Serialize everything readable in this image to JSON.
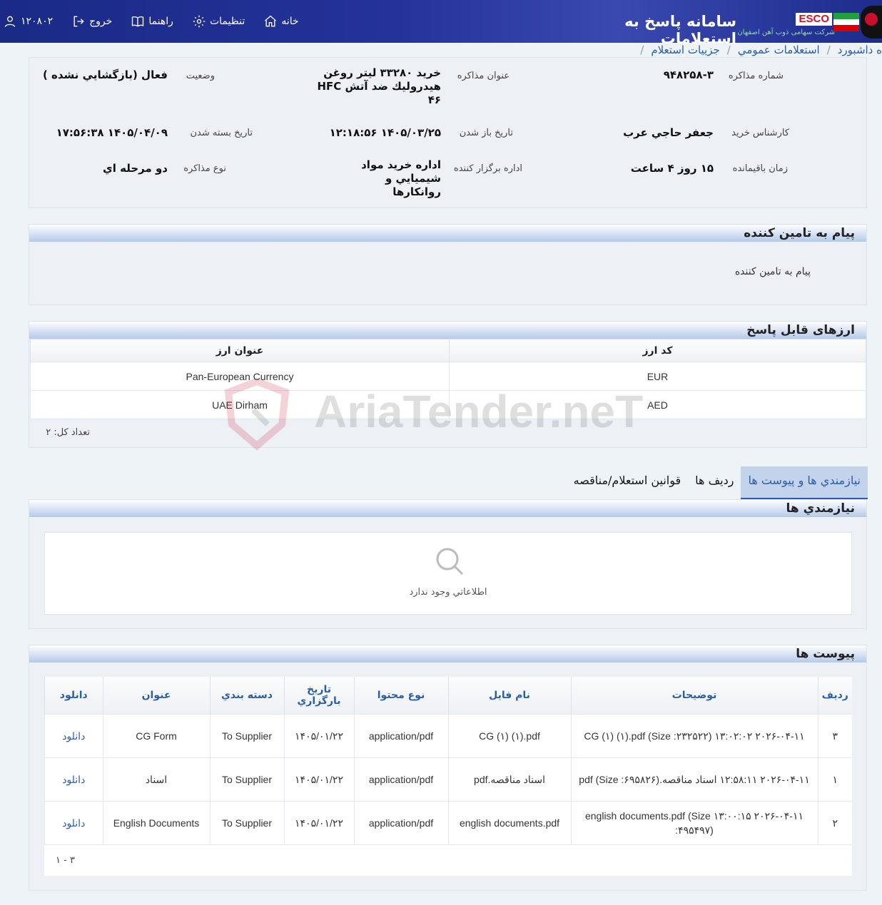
{
  "header": {
    "title": "سامانه پاسخ به استعلامات",
    "logo_text": "ESCO",
    "company": "شرکت سهامی ذوب آهن اصفهان",
    "nav": {
      "home": "خانه",
      "settings": "تنظیمات",
      "help": "راهنما",
      "logout": "خروج",
      "user": "۱۲۰۸۰۲"
    }
  },
  "breadcrumb": {
    "dashboard": "ه داشبورد",
    "public": "استعلامات عمومي",
    "details": "جزييات استعلام"
  },
  "info": {
    "number_label": "شماره مذاکره",
    "number_value": "۹۴۸۲۵۸-۳",
    "subject_label": "عنوان مذاکره",
    "subject_value": "خرید ۳۳۲۸۰ لیتر روغن هیدرولیك ضد آتش HFC ۴۶",
    "status_label": "وضعيت",
    "status_value": "فعال (بازگشايي نشده )",
    "expert_label": "كارشناس خريد",
    "expert_value": "جعفر حاجي عرب",
    "open_label": "تاريخ باز شدن",
    "open_value": "۱۴۰۵/۰۳/۲۵ ۱۲:۱۸:۵۶",
    "close_label": "تاريخ بسته شدن",
    "close_value": "۱۴۰۵/۰۴/۰۹ ۱۷:۵۶:۳۸",
    "remaining_label": "زمان باقيمانده",
    "remaining_value": "۱۵ روز ۴ ساعت",
    "office_label": "اداره برگزار کننده",
    "office_value": "اداره خريد مواد شيميايي و روانكارها",
    "type_label": "نوع مذاكره",
    "type_value": "دو مرحله اي"
  },
  "message": {
    "title": "پيام به تامين كننده",
    "text": "پيام به تامين كننده"
  },
  "currencies": {
    "title": "ارزهای قابل پاسخ",
    "col_code": "کد ارز",
    "col_title": "عنوان ارز",
    "rows": [
      {
        "code": "EUR",
        "title": "Pan-European Currency"
      },
      {
        "code": "AED",
        "title": "UAE Dirham"
      }
    ],
    "count": "تعداد كل: ۲"
  },
  "tabs": {
    "needs_attach": "نيازمندي ها و پيوست ها",
    "rows": "رديف ها",
    "rules": "قوانين استعلام/مناقصه"
  },
  "needs": {
    "title": "نيازمندي ها",
    "empty": "اطلاعاتي وجود ندارد"
  },
  "attachments": {
    "title": "پيوست ها",
    "headers": {
      "row": "رديف",
      "desc": "توضيحات",
      "file": "نام فايل",
      "type": "نوع محتوا",
      "date": "تاريخ بارگزاري",
      "category": "دسته بندي",
      "name": "عنوان",
      "download": "دانلود"
    },
    "rows": [
      {
        "row": "۳",
        "desc": "۲۰۲۶-۰۴-۱۱ ۱۳:۰۲:۰۲ CG (۱) (۱).pdf (Size :۲۳۲۵۲۲)",
        "file": "CG (۱) (۱).pdf",
        "type": "application/pdf",
        "date": "۱۴۰۵/۰۱/۲۲",
        "category": "To Supplier",
        "name": "CG Form",
        "download": "دانلود"
      },
      {
        "row": "۱",
        "desc": "۲۰۲۶-۰۴-۱۱ ۱۲:۵۸:۱۱ اسناد مناقصه.pdf (Size :۶۹۵۸۲۶)",
        "file": "اسناد مناقصه.pdf",
        "type": "application/pdf",
        "date": "۱۴۰۵/۰۱/۲۲",
        "category": "To Supplier",
        "name": "اسناد",
        "download": "دانلود"
      },
      {
        "row": "۲",
        "desc": "۲۰۲۶-۰۴-۱۱ ۱۳:۰۰:۱۵ english documents.pdf (Size :۴۹۵۴۹۷)",
        "file": "english documents.pdf",
        "type": "application/pdf",
        "date": "۱۴۰۵/۰۱/۲۲",
        "category": "To Supplier",
        "name": "English Documents",
        "download": "دانلود"
      }
    ],
    "pager": "۱ - ۳"
  },
  "watermark": "AriaTender.neT"
}
